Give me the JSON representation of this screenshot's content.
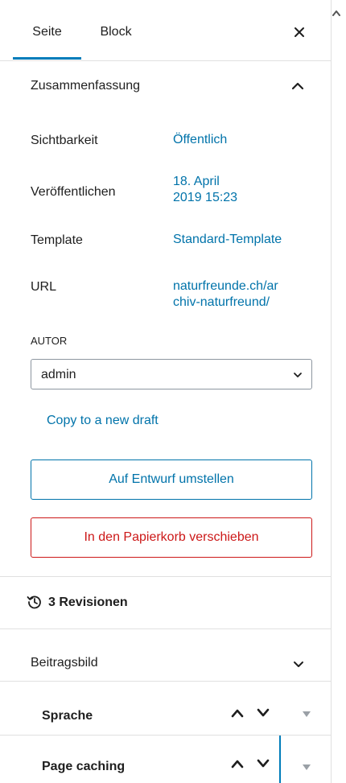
{
  "tabs": {
    "page": "Seite",
    "block": "Block",
    "close": "×"
  },
  "summary": {
    "title": "Zusammenfassung",
    "visibility_label": "Sichtbarkeit",
    "visibility_value": "Öffentlich",
    "publish_label": "Veröffentlichen",
    "publish_value_line1": "18. April",
    "publish_value_line2": "2019 15:23",
    "template_label": "Template",
    "template_value": "Standard-Template",
    "url_label": "URL",
    "url_value_line1": "naturfreunde.ch/ar",
    "url_value_line2": "chiv-naturfreund/",
    "author_label": "AUTOR",
    "author_value": "admin",
    "copy_link": "Copy to a new draft",
    "switch_draft_button": "Auf Entwurf umstellen",
    "trash_button": "In den Papierkorb verschieben"
  },
  "revisions": {
    "label": "3 Revisionen",
    "icon": "history-icon"
  },
  "featured_image": {
    "title": "Beitragsbild"
  },
  "language": {
    "title": "Sprache"
  },
  "page_caching": {
    "title": "Page caching"
  },
  "colors": {
    "accent": "#007cba",
    "link": "#0073aa",
    "danger": "#cc1818",
    "border": "#e0e0e0"
  }
}
